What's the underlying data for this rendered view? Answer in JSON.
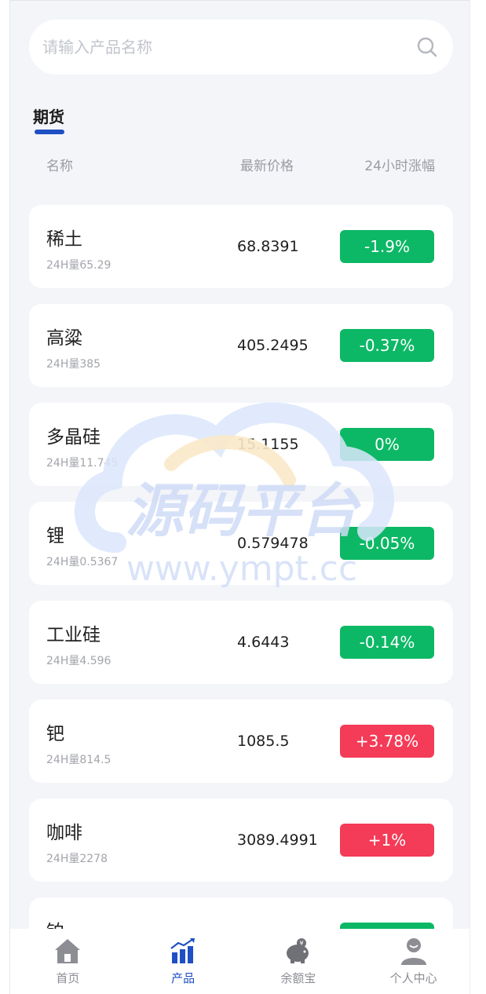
{
  "search": {
    "placeholder": "请输入产品名称"
  },
  "section": {
    "tab_label": "期货"
  },
  "columns": {
    "name": "名称",
    "price": "最新价格",
    "change": "24小时涨幅"
  },
  "colors": {
    "up": "#f43b57",
    "down": "#0cb865",
    "accent": "#1f4fc4"
  },
  "items": [
    {
      "name": "稀土",
      "volume": "24H量65.29",
      "price": "68.8391",
      "change": "-1.9%",
      "direction": "down"
    },
    {
      "name": "高粱",
      "volume": "24H量385",
      "price": "405.2495",
      "change": "-0.37%",
      "direction": "down"
    },
    {
      "name": "多晶硅",
      "volume": "24H量11.745",
      "price": "15.1155",
      "change": "0%",
      "direction": "down"
    },
    {
      "name": "锂",
      "volume": "24H量0.5367",
      "price": "0.579478",
      "change": "-0.05%",
      "direction": "down"
    },
    {
      "name": "工业硅",
      "volume": "24H量4.596",
      "price": "4.6443",
      "change": "-0.14%",
      "direction": "down"
    },
    {
      "name": "钯",
      "volume": "24H量814.5",
      "price": "1085.5",
      "change": "+3.78%",
      "direction": "up"
    },
    {
      "name": "咖啡",
      "volume": "24H量2278",
      "price": "3089.4991",
      "change": "+1%",
      "direction": "up"
    },
    {
      "name": "铂",
      "volume": "",
      "price": "",
      "change": "",
      "direction": "down"
    }
  ],
  "watermark": {
    "title": "源码平台",
    "url": "www.ympt.cc"
  },
  "tabbar": [
    {
      "label": "首页",
      "icon": "home-icon",
      "active": false
    },
    {
      "label": "产品",
      "icon": "chart-icon",
      "active": true
    },
    {
      "label": "余额宝",
      "icon": "piggy-bank-icon",
      "active": false
    },
    {
      "label": "个人中心",
      "icon": "user-icon",
      "active": false
    }
  ]
}
